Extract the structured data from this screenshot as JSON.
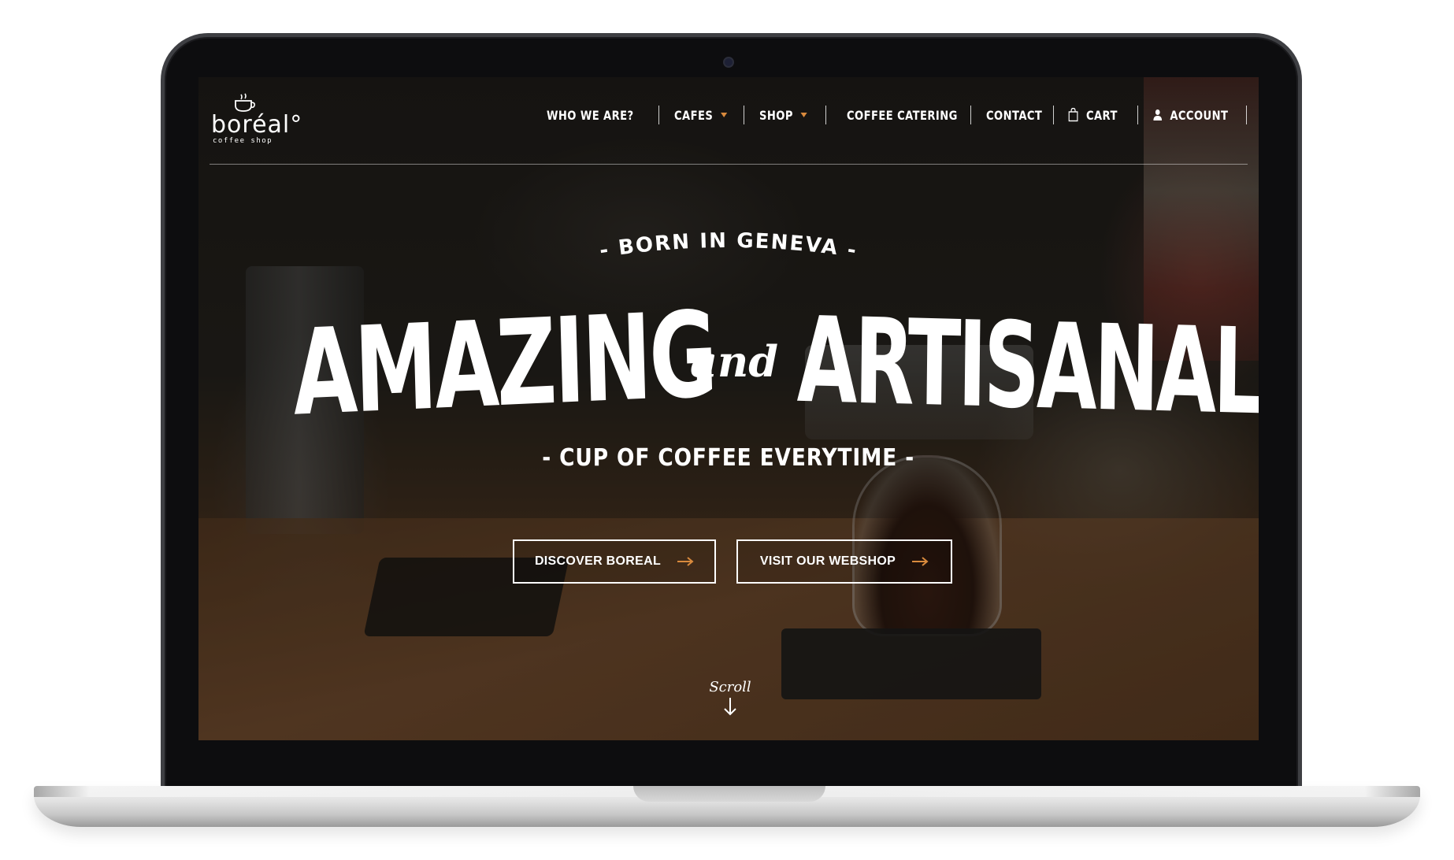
{
  "brand": {
    "logo_word": "boréal°",
    "logo_tagline": "coffee shop"
  },
  "nav": {
    "items": [
      {
        "label": "WHO WE ARE?",
        "has_dropdown": false
      },
      {
        "label": "CAFES",
        "has_dropdown": true
      },
      {
        "label": "SHOP",
        "has_dropdown": true
      },
      {
        "label": "COFFEE CATERING",
        "has_dropdown": false
      },
      {
        "label": "CONTACT",
        "has_dropdown": false
      },
      {
        "label": "CART",
        "icon": "shopping-bag-icon"
      },
      {
        "label": "ACCOUNT",
        "icon": "user-icon"
      }
    ],
    "dropdown_caret_color": "#d98a3d"
  },
  "hero": {
    "eyebrow": "- BORN IN GENEVA -",
    "title_left": "AMAZING",
    "title_connector": "and",
    "title_right": "ARTISANAL",
    "subtitle": "- CUP OF COFFEE EVERYTIME -",
    "buttons": [
      {
        "label": "DISCOVER BOREAL",
        "icon": "arrow-right-icon"
      },
      {
        "label": "VISIT OUR WEBSHOP",
        "icon": "arrow-right-icon"
      }
    ],
    "scroll_label": "Scroll",
    "accent_color": "#d98a3d"
  }
}
